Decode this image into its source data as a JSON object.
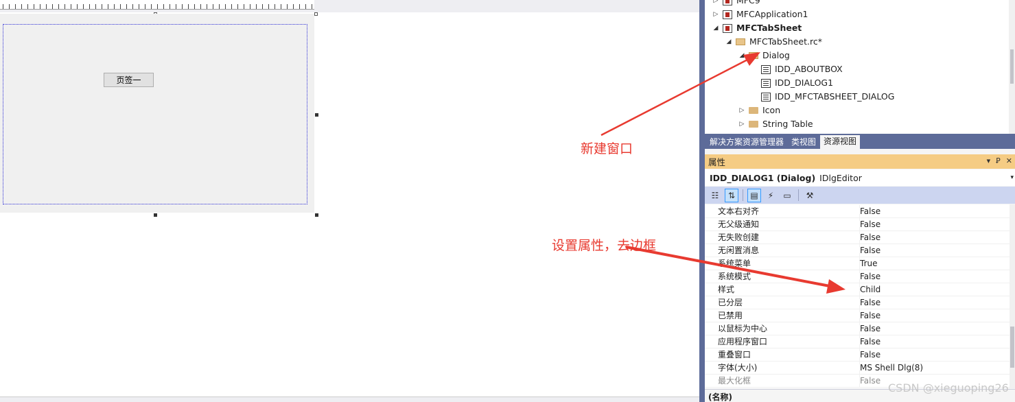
{
  "editor": {
    "tab_button_label": "页签一"
  },
  "annotations": {
    "new_window": "新建窗口",
    "set_props": "设置属性，去边框"
  },
  "tree": {
    "rows": [
      {
        "label": "MFC9",
        "expander": "▷"
      },
      {
        "label": "MFCApplication1",
        "expander": "▷"
      },
      {
        "label": "MFCTabSheet",
        "expander": "◢"
      },
      {
        "label": "MFCTabSheet.rc*",
        "expander": "◢"
      },
      {
        "label": "Dialog",
        "expander": "◢"
      },
      {
        "label": "IDD_ABOUTBOX",
        "expander": ""
      },
      {
        "label": "IDD_DIALOG1",
        "expander": ""
      },
      {
        "label": "IDD_MFCTABSHEET_DIALOG",
        "expander": ""
      },
      {
        "label": "Icon",
        "expander": "▷"
      },
      {
        "label": "String Table",
        "expander": "▷"
      }
    ]
  },
  "tabs": [
    "解决方案资源管理器",
    "类视图",
    "资源视图"
  ],
  "properties": {
    "panel_title": "属性",
    "pin_glyph": "Ꝑ",
    "close_glyph": "✕",
    "dropdown_glyph": "▾",
    "object_name": "IDD_DIALOG1 (Dialog)",
    "object_type": "IDlgEditor",
    "rows": [
      {
        "name": "文本右对齐",
        "value": "False"
      },
      {
        "name": "无父级通知",
        "value": "False"
      },
      {
        "name": "无失败创建",
        "value": "False"
      },
      {
        "name": "无闲置消息",
        "value": "False"
      },
      {
        "name": "系统菜单",
        "value": "True"
      },
      {
        "name": "系统模式",
        "value": "False"
      },
      {
        "name": "样式",
        "value": "Child"
      },
      {
        "name": "已分层",
        "value": "False"
      },
      {
        "name": "已禁用",
        "value": "False"
      },
      {
        "name": "以鼠标为中心",
        "value": "False"
      },
      {
        "name": "应用程序窗口",
        "value": "False"
      },
      {
        "name": "重叠窗口",
        "value": "False"
      },
      {
        "name": "字体(大小)",
        "value": "MS Shell Dlg(8)"
      },
      {
        "name": "最大化框",
        "value": "False"
      }
    ],
    "description": "(名称)"
  },
  "watermark": "CSDN @xieguoping26",
  "colors": {
    "annotation": "#e83a30",
    "panel_title_bg": "#f5cc84",
    "splitter": "#5d6b99"
  }
}
